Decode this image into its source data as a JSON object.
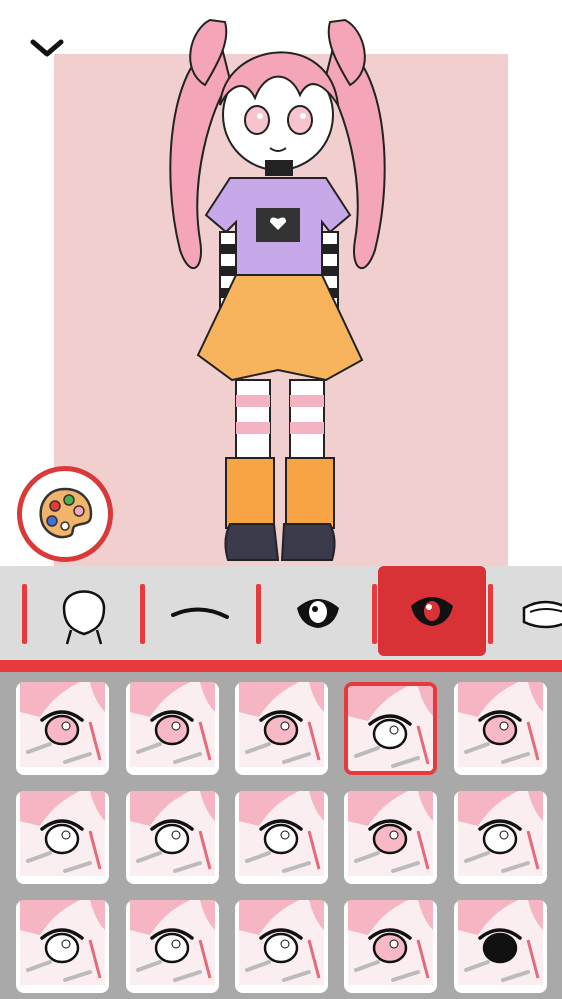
{
  "colors": {
    "accent": "#e8393c",
    "preview_bg": "#f1cfcf",
    "category_bg": "#dcdcdc",
    "grid_bg": "#a9a9a9",
    "hair": "#f4a6b8",
    "shirt": "#c7a9e9",
    "skirt": "#f7b45d"
  },
  "header": {
    "collapse_icon": "chevron-down-icon"
  },
  "palette_button": {
    "icon": "palette-icon"
  },
  "categories": [
    {
      "id": "face-shape",
      "icon": "face-outline-icon",
      "selected": false
    },
    {
      "id": "eyebrows",
      "icon": "eyebrow-icon",
      "selected": false
    },
    {
      "id": "eye-shape",
      "icon": "eye-lash-icon",
      "selected": false
    },
    {
      "id": "eyes",
      "icon": "eye-filled-icon",
      "selected": true
    },
    {
      "id": "glasses",
      "icon": "glasses-icon",
      "selected": false
    }
  ],
  "eye_options": [
    {
      "style": "drowsy-pink",
      "selected": false
    },
    {
      "style": "almond-pink",
      "selected": false
    },
    {
      "style": "sharp-pink",
      "selected": false
    },
    {
      "style": "round-outline",
      "selected": true
    },
    {
      "style": "sparkle-pink",
      "selected": false
    },
    {
      "style": "round-white",
      "selected": false
    },
    {
      "style": "big-round",
      "selected": false
    },
    {
      "style": "dotted",
      "selected": false
    },
    {
      "style": "narrow-pink",
      "selected": false
    },
    {
      "style": "narrow-lined",
      "selected": false
    },
    {
      "style": "closed-lashes",
      "selected": false
    },
    {
      "style": "half-closed",
      "selected": false
    },
    {
      "style": "sleepy-lined",
      "selected": false
    },
    {
      "style": "pink-heavy",
      "selected": false
    },
    {
      "style": "black-eye",
      "selected": false
    }
  ]
}
